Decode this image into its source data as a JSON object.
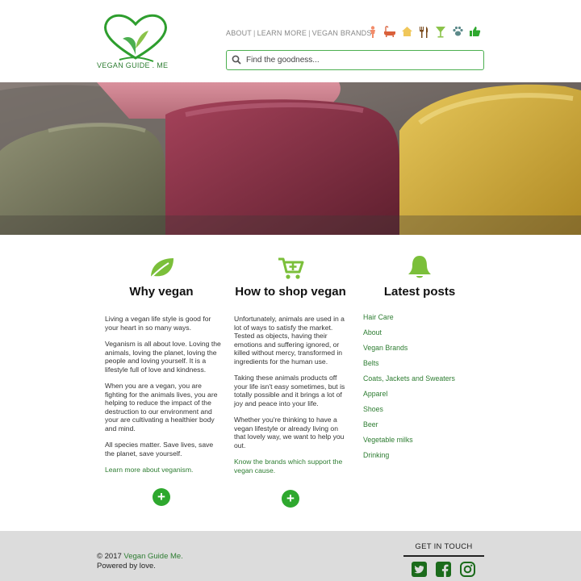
{
  "brand": {
    "name": "VEGAN GUIDE . ME",
    "accent": "#2e7d32",
    "button_green": "#2ea82e"
  },
  "nav": {
    "about": "ABOUT",
    "learn_more": "LEARN MORE",
    "vegan_brands": "VEGAN BRANDS",
    "separator": "|",
    "category_icons": [
      "person-icon",
      "bathtub-icon",
      "home-icon",
      "fork-knife-icon",
      "cocktail-icon",
      "paw-icon",
      "thumbs-up-icon"
    ]
  },
  "search": {
    "placeholder": "Find the goodness..."
  },
  "hero": {
    "slide_count": 8,
    "active_slide": 3
  },
  "why_vegan": {
    "icon": "leaf-icon",
    "title": "Why vegan",
    "paragraphs": [
      "Living a vegan life style is good for your heart in so many ways.",
      "Veganism is all about love. Loving the animals, loving the planet, loving the people and loving yourself. It is a lifestyle full of love and kindness.",
      "When you are a vegan, you are fighting for the animals lives, you are helping to reduce the impact of the destruction to our environment and your are cultivating a healthier body and mind.",
      "All species matter. Save lives, save the planet, save yourself."
    ],
    "link": "Learn more about veganism."
  },
  "how_to_shop": {
    "icon": "cart-plus-icon",
    "title": "How to shop vegan",
    "paragraphs": [
      "Unfortunately, animals are used in a lot of ways to satisfy the market. Tested as objects, having their emotions and suffering ignored, or killed without mercy, transformed in ingredients for the human use.",
      "Taking these animals products off your life isn't easy sometimes, but is totally possible and it brings a lot of joy and peace into your life.",
      "Whether you're thinking to have a vegan lifestyle or already living on that lovely way, we want to help you out."
    ],
    "link": "Know the brands which support the vegan cause."
  },
  "latest_posts": {
    "icon": "bell-icon",
    "title": "Latest posts",
    "items": [
      "Hair Care",
      "About",
      "Vegan Brands",
      "Belts",
      "Coats, Jackets and Sweaters",
      "Apparel",
      "Shoes",
      "Beer",
      "Vegetable milks",
      "Drinking"
    ]
  },
  "plus_label": "+",
  "footer": {
    "copyright_prefix": "© 2017 ",
    "copyright_link": "Vegan Guide Me.",
    "tagline": "Powered by love.",
    "get_in_touch": "GET IN TOUCH",
    "social": [
      "twitter-icon",
      "facebook-icon",
      "instagram-icon"
    ]
  }
}
